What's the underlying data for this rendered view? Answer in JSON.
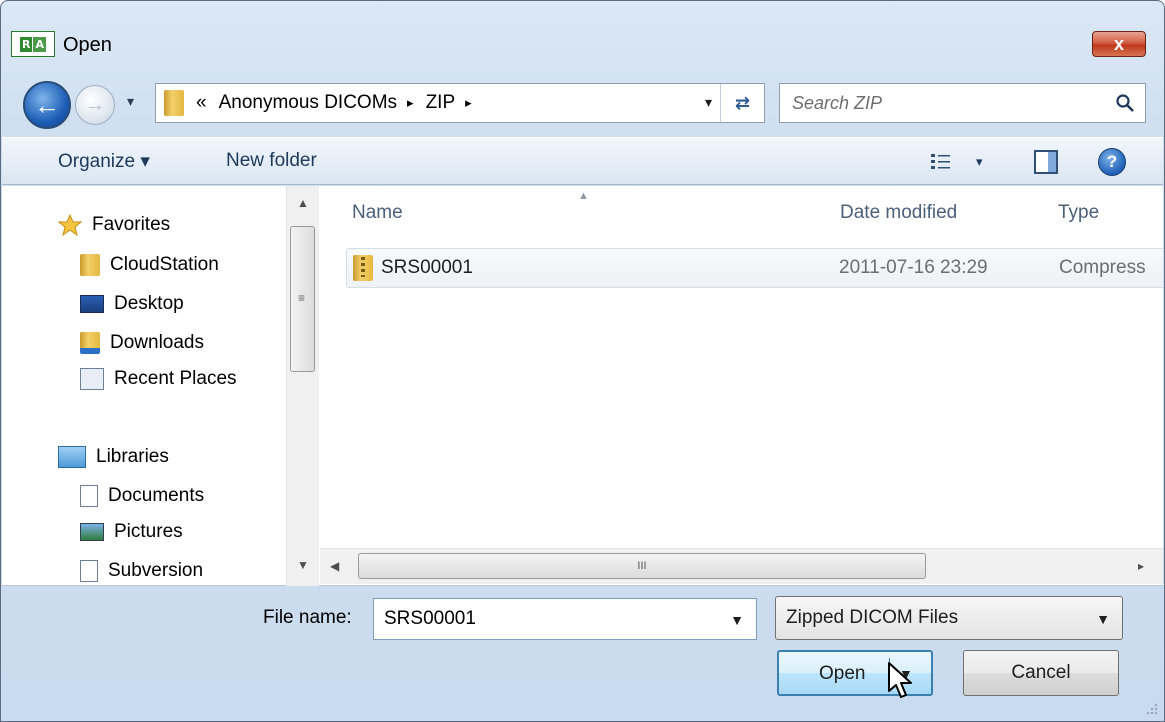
{
  "window": {
    "title": "Open",
    "app_icon_left": "R",
    "app_icon_right": "A",
    "close_symbol": "x"
  },
  "nav": {
    "back_symbol": "←",
    "forward_symbol": "→",
    "recent_dropdown_symbol": "▾",
    "breadcrumb": {
      "prefix": "«",
      "items": [
        "Anonymous DICOMs",
        "ZIP"
      ],
      "separator": "▸"
    },
    "address_dropdown_symbol": "▾",
    "refresh_symbol": "⇄",
    "search": {
      "placeholder": "Search ZIP",
      "value": ""
    }
  },
  "toolbar": {
    "organize_label": "Organize ▾",
    "new_folder_label": "New folder",
    "views_dropdown_symbol": "▾",
    "help_symbol": "?"
  },
  "sidebar": {
    "favorites": {
      "label": "Favorites",
      "items": [
        "CloudStation",
        "Desktop",
        "Downloads",
        "Recent Places"
      ]
    },
    "libraries": {
      "label": "Libraries",
      "items": [
        "Documents",
        "Pictures",
        "Subversion"
      ]
    }
  },
  "file_list": {
    "columns": [
      "Name",
      "Date modified",
      "Type"
    ],
    "rows": [
      {
        "name": "SRS00001",
        "date_modified": "2011-07-16 23:29",
        "type": "Compress"
      }
    ]
  },
  "scroll": {
    "up_symbol": "▲",
    "down_symbol": "▼",
    "left_symbol": "◀",
    "right_symbol": "▸",
    "grip": "≡",
    "hgrip": "III"
  },
  "footer": {
    "file_name_label": "File name:",
    "file_name_value": "SRS00001",
    "file_name_dropdown_symbol": "▼",
    "file_type_value": "Zipped DICOM Files",
    "file_type_dropdown_symbol": "▼",
    "open_label": "Open",
    "open_dropdown_symbol": "▼",
    "cancel_label": "Cancel"
  },
  "colors": {
    "accent": "#3c7fb1",
    "close_red": "#c2381c",
    "folder_yellow": "#e5b840"
  }
}
